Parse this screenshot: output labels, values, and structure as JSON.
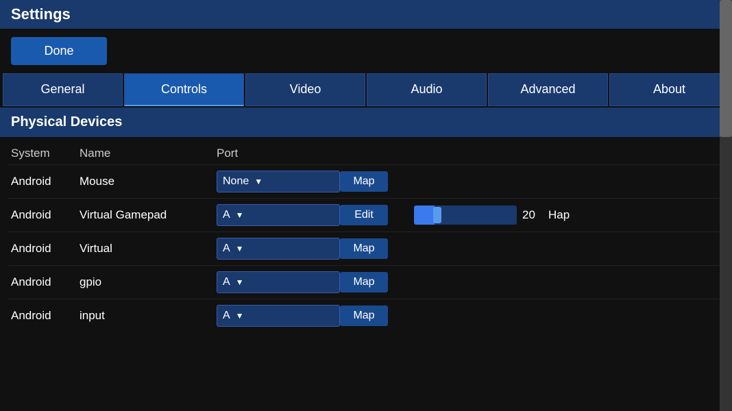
{
  "titleBar": {
    "label": "Settings"
  },
  "doneButton": {
    "label": "Done"
  },
  "tabs": [
    {
      "id": "general",
      "label": "General",
      "active": false
    },
    {
      "id": "controls",
      "label": "Controls",
      "active": true
    },
    {
      "id": "video",
      "label": "Video",
      "active": false
    },
    {
      "id": "audio",
      "label": "Audio",
      "active": false
    },
    {
      "id": "advanced",
      "label": "Advanced",
      "active": false
    },
    {
      "id": "about",
      "label": "About",
      "active": false
    }
  ],
  "sectionHeader": "Physical Devices",
  "tableHeaders": {
    "system": "System",
    "name": "Name",
    "port": "Port"
  },
  "devices": [
    {
      "system": "Android",
      "name": "Mouse",
      "port": "None",
      "action": "Map",
      "hasSlider": false
    },
    {
      "system": "Android",
      "name": "Virtual Gamepad",
      "port": "A",
      "action": "Edit",
      "hasSlider": true,
      "sliderValue": 20,
      "sliderLabel": "Hap"
    },
    {
      "system": "Android",
      "name": "Virtual",
      "port": "A",
      "action": "Map",
      "hasSlider": false
    },
    {
      "system": "Android",
      "name": "gpio",
      "port": "A",
      "action": "Map",
      "hasSlider": false
    },
    {
      "system": "Android",
      "name": "input",
      "port": "A",
      "action": "Map",
      "hasSlider": false
    }
  ]
}
